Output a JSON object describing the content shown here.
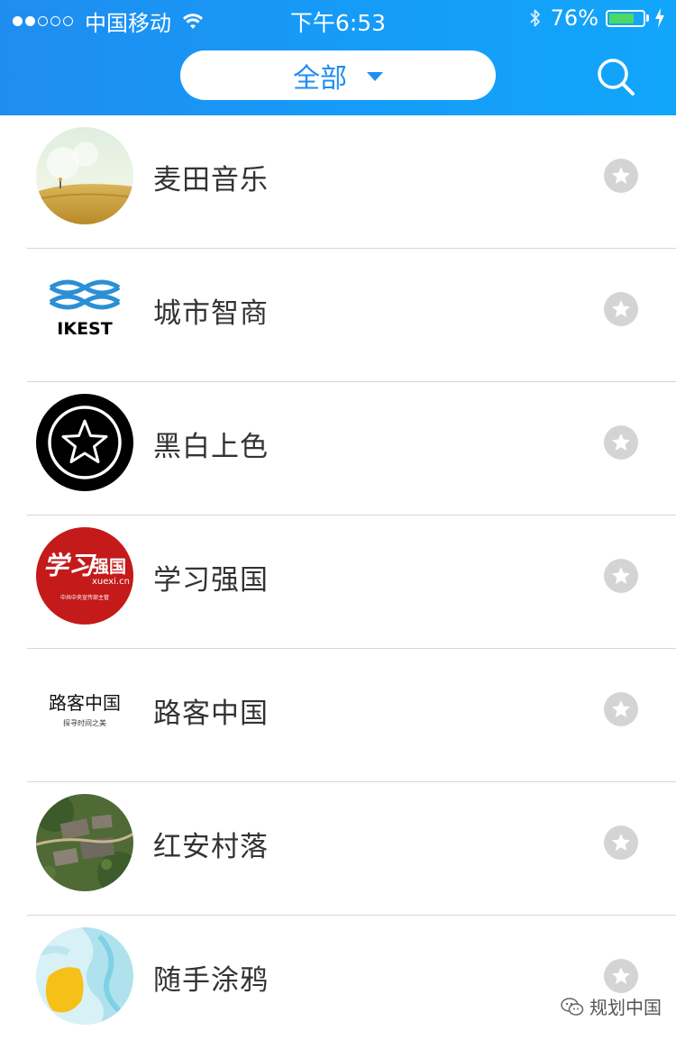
{
  "status_bar": {
    "carrier": "中国移动",
    "time": "下午6:53",
    "battery_percent": "76%",
    "battery_level": 0.76,
    "signal_filled_dots": 2,
    "signal_total_dots": 5,
    "icons": [
      "wifi-icon",
      "bluetooth-icon",
      "battery-icon",
      "charging-bolt-icon"
    ]
  },
  "header": {
    "filter_label": "全部",
    "filter_icon": "caret-down-icon",
    "search_icon": "search-icon",
    "colors": {
      "header_blue": "#1a96f5",
      "accent": "#1f8df0"
    }
  },
  "apps": [
    {
      "name": "麦田音乐",
      "logo": "wheat-field-image",
      "favorite_icon": "star-icon"
    },
    {
      "name": "城市智商",
      "logo": "ikest-logo",
      "logo_text": "IKEST",
      "favorite_icon": "star-icon"
    },
    {
      "name": "黑白上色",
      "logo": "black-star-logo",
      "favorite_icon": "star-icon"
    },
    {
      "name": "学习强国",
      "logo": "xuexi-logo",
      "logo_text": [
        "学习",
        "强国",
        "xuexi.cn",
        "中共中央宣传部主管"
      ],
      "favorite_icon": "star-icon"
    },
    {
      "name": "路客中国",
      "logo": "luke-calligraphy-logo",
      "logo_text": [
        "路客中国",
        "探寻时间之美"
      ],
      "favorite_icon": "star-icon"
    },
    {
      "name": "红安村落",
      "logo": "village-aerial-image",
      "favorite_icon": "star-icon"
    },
    {
      "name": "随手涂鸦",
      "logo": "doodle-paint-image",
      "favorite_icon": "star-icon"
    }
  ],
  "watermark": {
    "text": "规划中国",
    "icon": "wechat-icon"
  }
}
